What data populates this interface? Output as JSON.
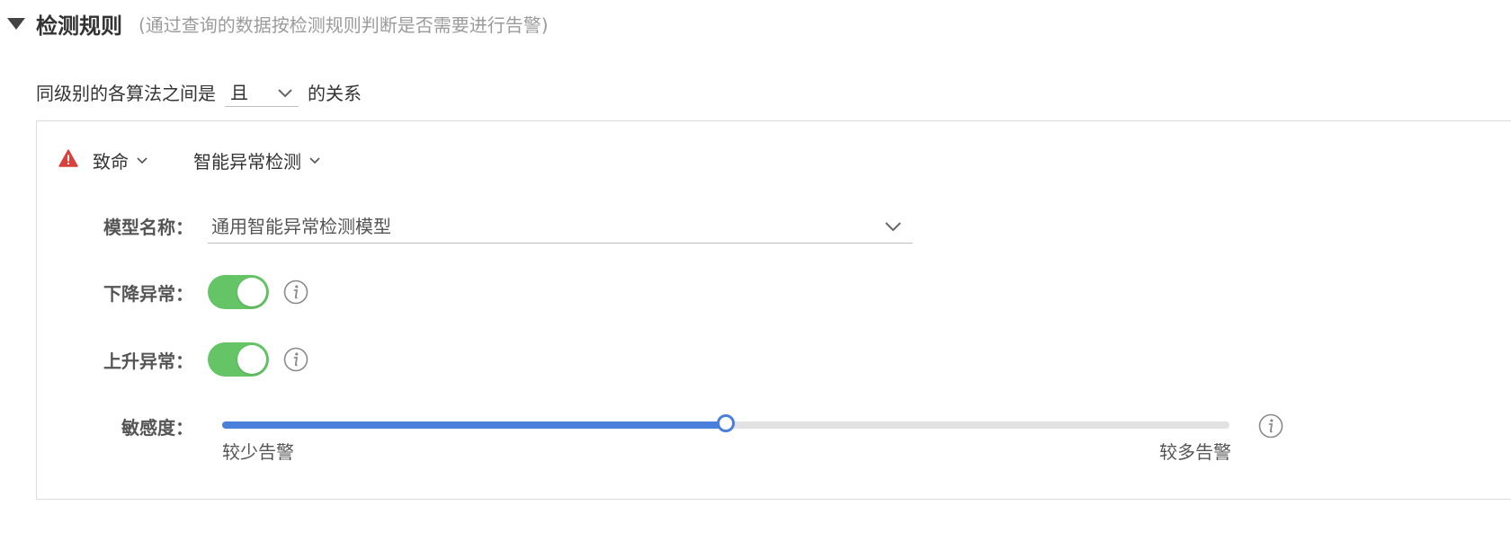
{
  "section": {
    "title": "检测规则",
    "description": "(通过查询的数据按检测规则判断是否需要进行告警)"
  },
  "relation": {
    "prefix": "同级别的各算法之间是",
    "selected": "且",
    "suffix": "的关系"
  },
  "rule": {
    "level_label": "致命",
    "level_color": "#d9413a",
    "algorithm_label": "智能异常检测",
    "model": {
      "label": "模型名称：",
      "value": "通用智能异常检测模型"
    },
    "decline": {
      "label": "下降异常：",
      "enabled": true
    },
    "rise": {
      "label": "上升异常：",
      "enabled": true
    },
    "sensitivity": {
      "label": "敏感度：",
      "value": 0.5,
      "min_label": "较少告警",
      "max_label": "较多告警"
    }
  },
  "colors": {
    "toggle_on": "#64c466",
    "slider_accent": "#4a7fdb"
  }
}
